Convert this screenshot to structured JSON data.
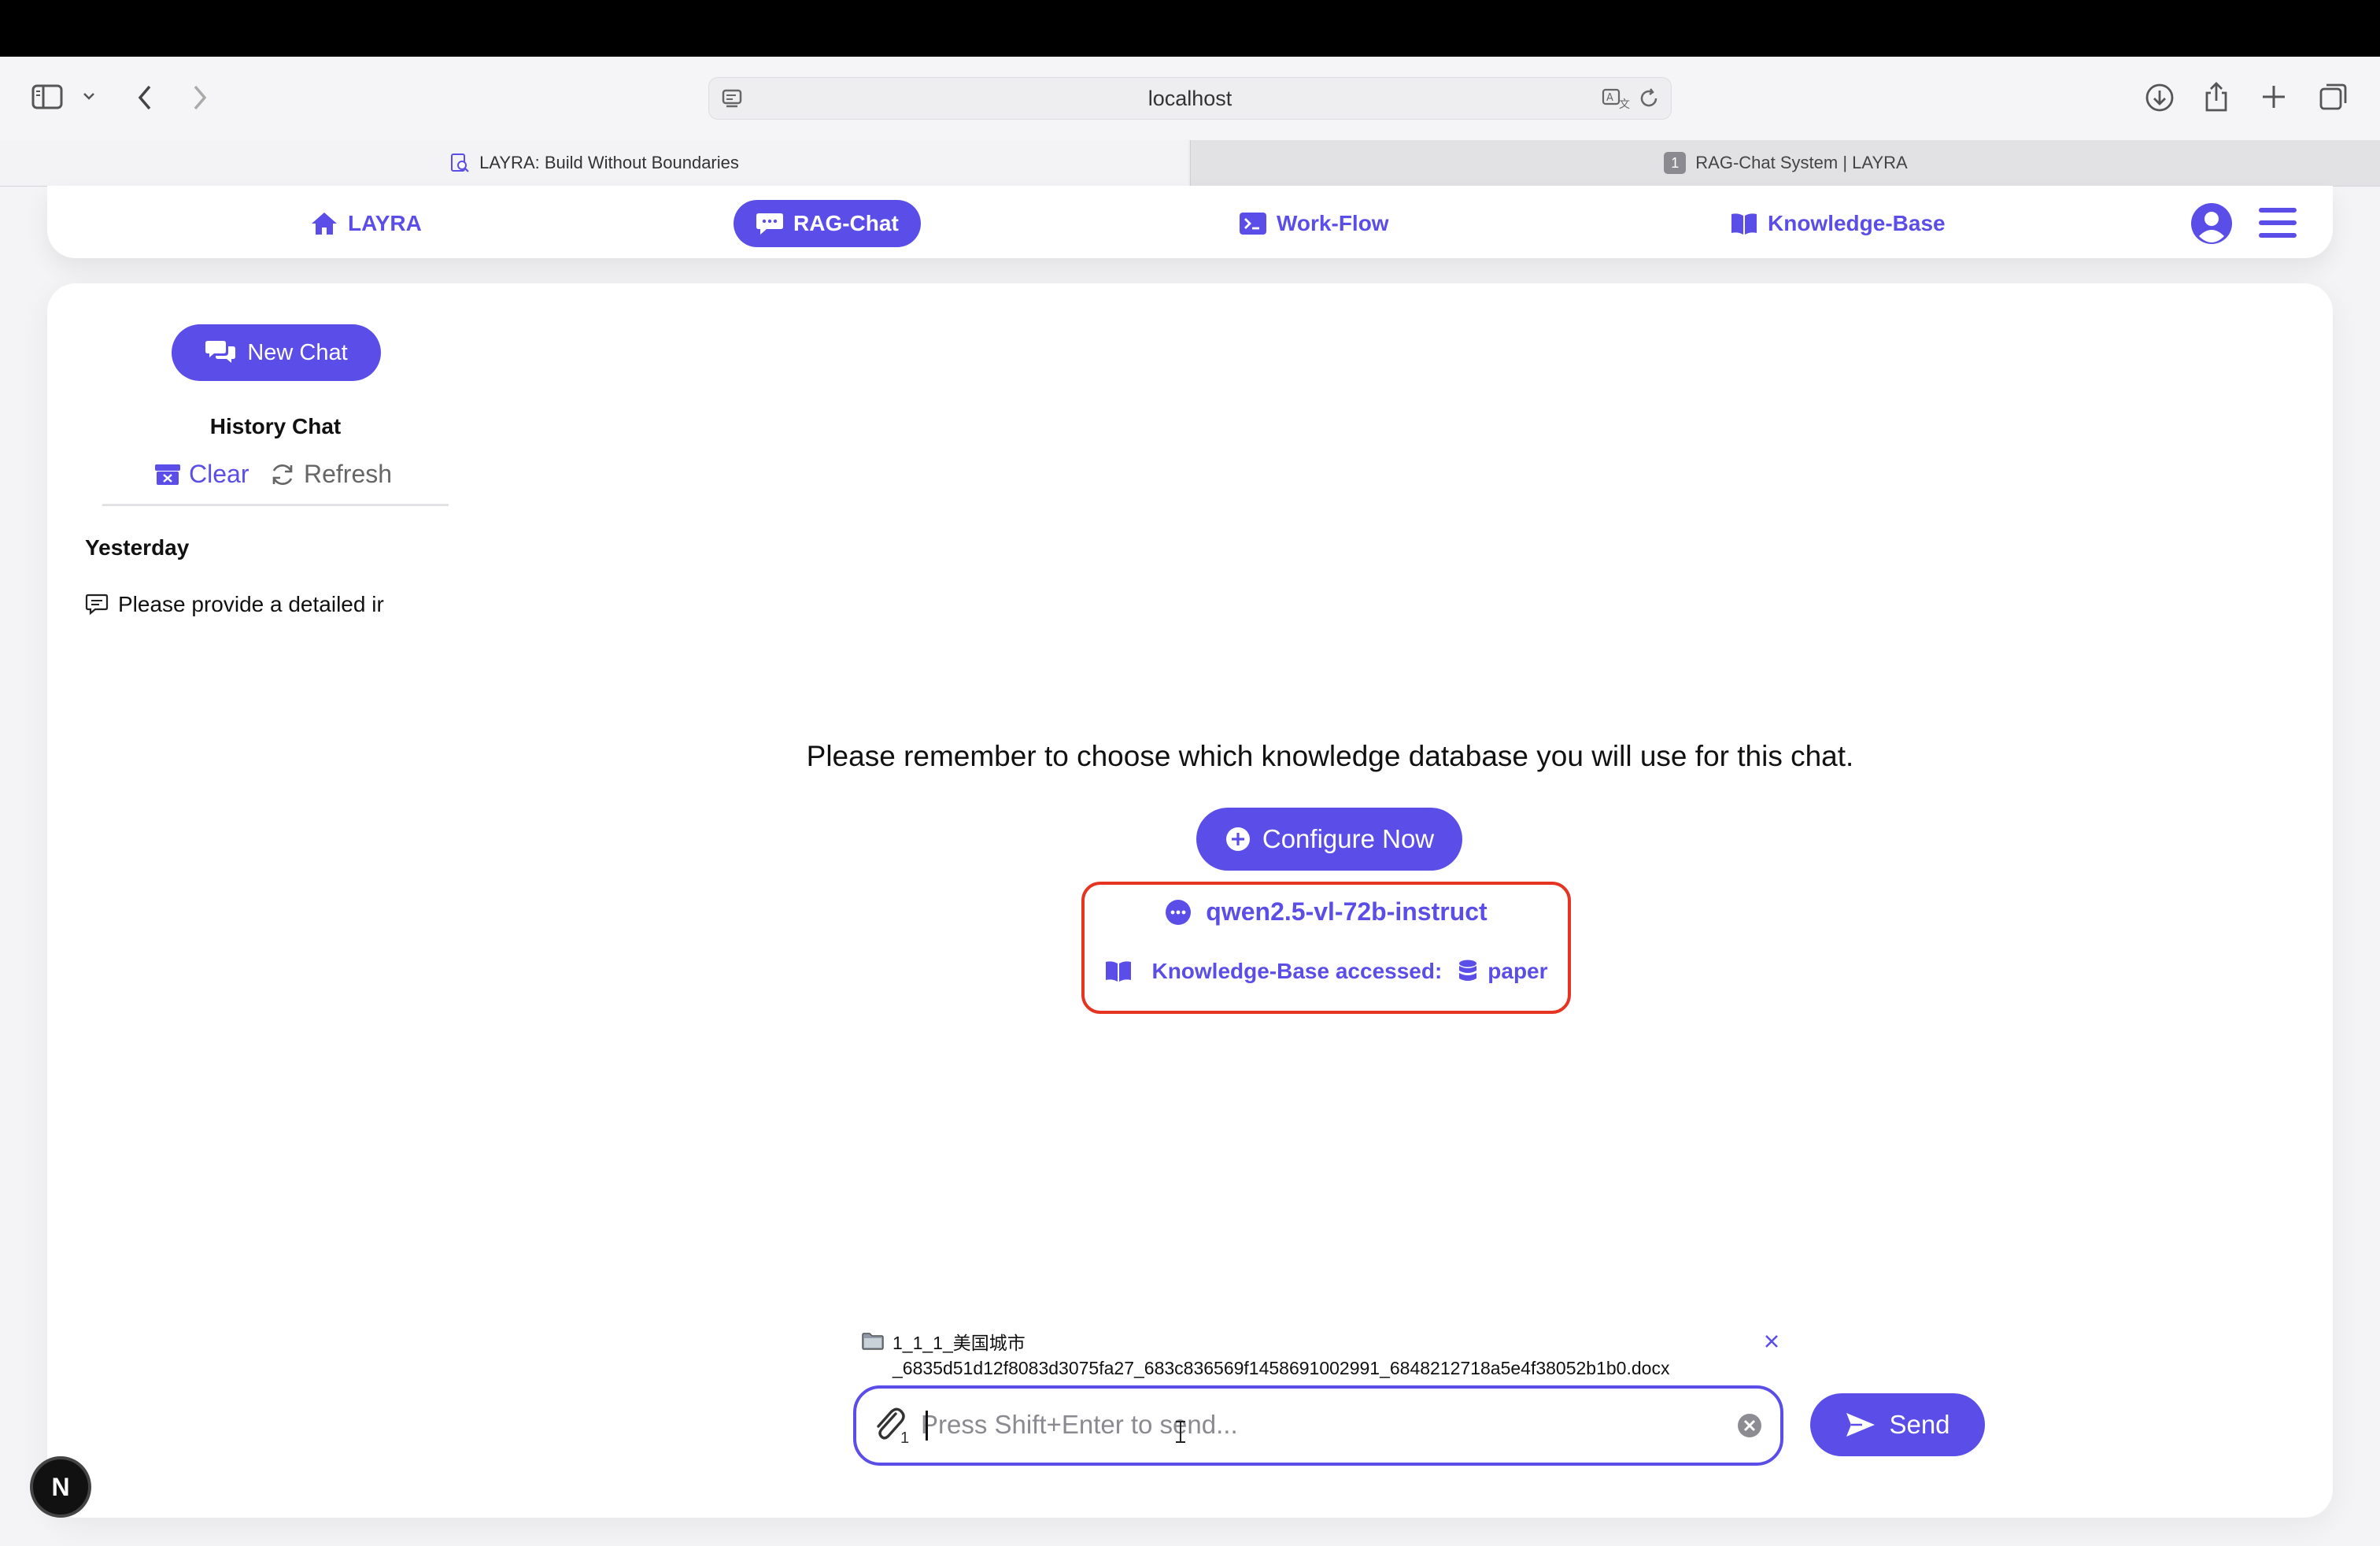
{
  "browser": {
    "url": "localhost",
    "tabs": [
      {
        "label": "LAYRA: Build Without Boundaries"
      },
      {
        "badge": "1",
        "label": "RAG-Chat System | LAYRA"
      }
    ]
  },
  "nav": {
    "items": [
      {
        "label": "LAYRA",
        "icon": "home-icon"
      },
      {
        "label": "RAG-Chat",
        "icon": "chat-icon"
      },
      {
        "label": "Work-Flow",
        "icon": "terminal-icon"
      },
      {
        "label": "Knowledge-Base",
        "icon": "book-icon"
      }
    ]
  },
  "sidebar": {
    "new_chat": "New Chat",
    "history_title": "History Chat",
    "clear": "Clear",
    "refresh": "Refresh",
    "groups": [
      {
        "label": "Yesterday",
        "items": [
          "Please provide a detailed ir"
        ]
      }
    ]
  },
  "main": {
    "prompt": "Please remember to choose which knowledge database you will use for this chat.",
    "configure": "Configure Now",
    "model": "qwen2.5-vl-72b-instruct",
    "kb_label": "Knowledge-Base accessed:",
    "kb_name": "paper"
  },
  "composer": {
    "file_line1": "1_1_1_美国城市",
    "file_line2": "_6835d51d12f8083d3075fa27_683c836569f1458691002991_6848212718a5e4f38052b1b0.docx",
    "attach_count": "1",
    "placeholder": "Press Shift+Enter to send...",
    "send": "Send"
  },
  "badge": {
    "label": "N"
  },
  "colors": {
    "accent": "#5b4ee8",
    "highlight_border": "#e53422"
  }
}
